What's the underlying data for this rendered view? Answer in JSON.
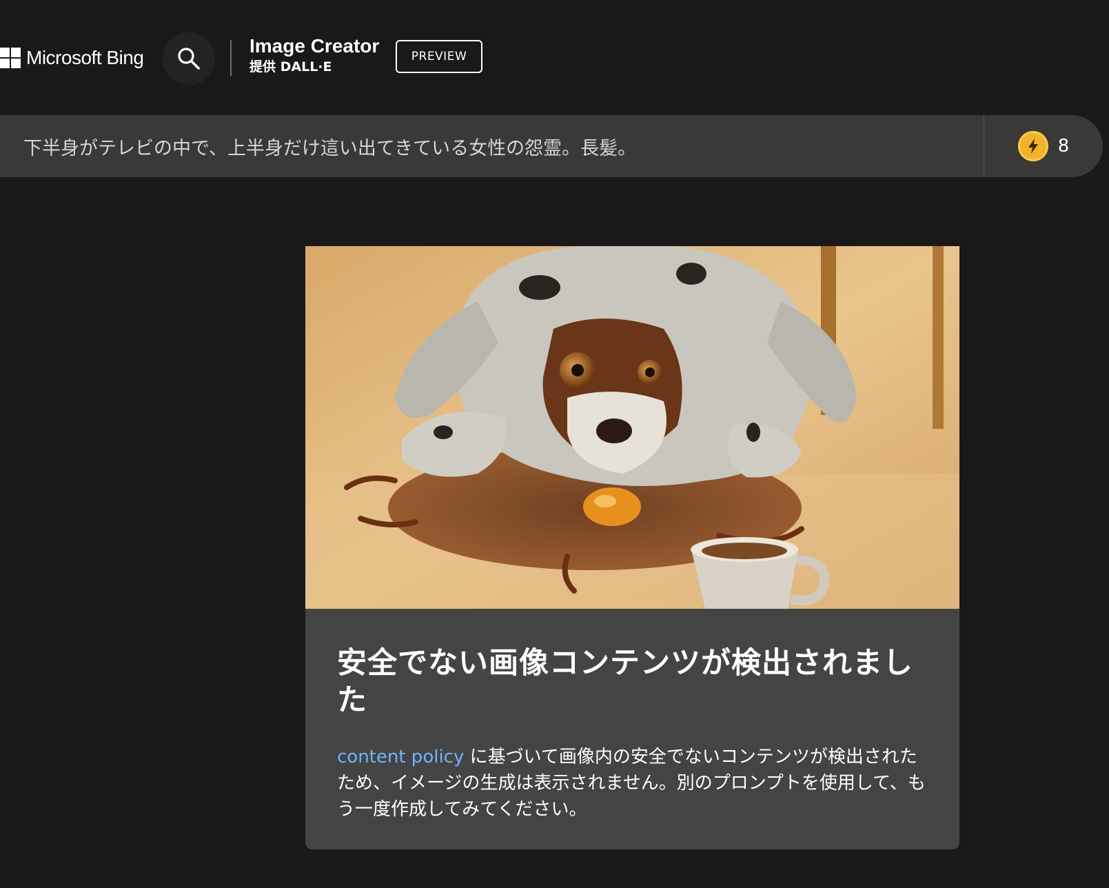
{
  "header": {
    "brand": "Microsoft Bing",
    "app_title": "Image Creator",
    "app_subtitle": "提供 DALL·E",
    "preview_label": "PREVIEW"
  },
  "prompt": {
    "text": "下半身がテレビの中で、上半身だけ這い出てきている女性の怨霊。長髪。",
    "boost_count": "8",
    "boost_icon": "lightning-coin-icon"
  },
  "result": {
    "image_description": "painting of a spotted dog lying on a table next to a spilled coffee cup",
    "title": "安全でない画像コンテンツが検出されました",
    "link_text": "content policy",
    "message": " に基づいて画像内の安全でないコンテンツが検出されたため、イメージの生成は表示されません。別のプロンプトを使用して、もう一度作成してみてください。"
  },
  "colors": {
    "background": "#1a1918",
    "prompt_bar": "#3a3938",
    "card": "#444444",
    "link": "#70b4ff",
    "boost_coin": "#f2b32a"
  }
}
